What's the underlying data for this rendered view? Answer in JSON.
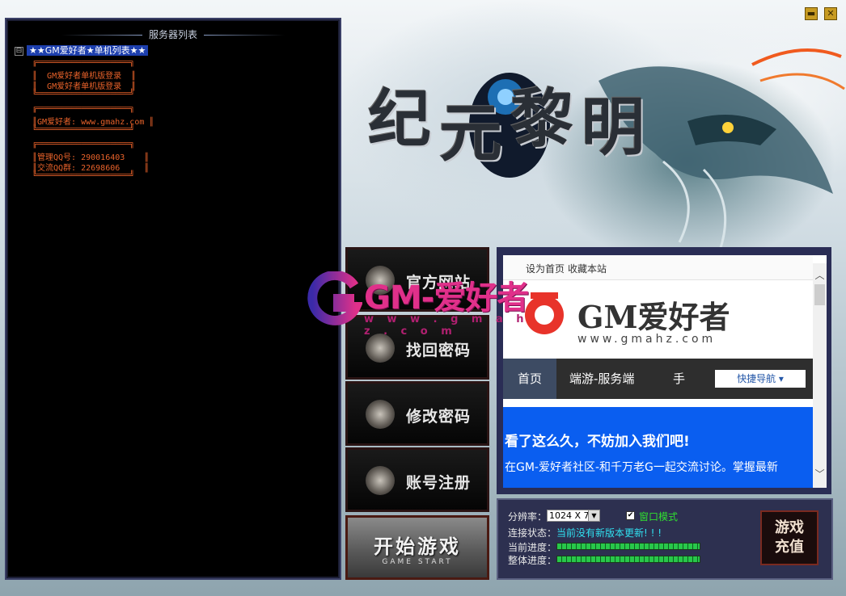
{
  "window": {
    "minimize_icon": "minimize-icon",
    "close_icon": "close-icon",
    "minimize_glyph": "▬",
    "close_glyph": "✕"
  },
  "server_list": {
    "title": "服务器列表",
    "root": "★★GM爱好者★单机列表★★",
    "expander": "⊟",
    "lines": [
      "╔═══════════════════╗",
      "║  GM爱好者单机版登录  ║",
      "║  GM爱好者单机版登录  ║",
      "╚═══════════════════╝",
      "╔═══════════════════╗",
      "║GM爱好者: www.gmahz.com ║",
      "╚═══════════════════╝",
      "╔═══════════════════╗",
      "║管理QQ号: 290016403    ║",
      "║交流QQ群: 22698606     ║",
      "╚═══════════════════╝"
    ]
  },
  "logo": {
    "chars": [
      "纪",
      "元",
      "黎",
      "明"
    ]
  },
  "side_buttons": [
    {
      "label": "官方网站",
      "icon": "emblem-icon"
    },
    {
      "label": "找回密码",
      "icon": "emblem-icon"
    },
    {
      "label": "修改密码",
      "icon": "emblem-icon"
    },
    {
      "label": "账号注册",
      "icon": "emblem-icon"
    }
  ],
  "start_button": {
    "label": "开始游戏",
    "sub": "GAME  START"
  },
  "browser": {
    "top_links": [
      "设为首页",
      "收藏本站"
    ],
    "site_name": "GM爱好者",
    "site_url": "www.gmahz.com",
    "nav": [
      "首页",
      "端游-服务端",
      "手"
    ],
    "quick_nav": "快捷导航 ▾",
    "banner_heading": "看了这么久，不妨加入我们吧!",
    "banner_text": "在GM-爱好者社区-和千万老G一起交流讨论。掌握最新",
    "scroll_up": "︿",
    "scroll_down": "﹀"
  },
  "settings": {
    "resolution_label": "分辨率：",
    "resolution_value": "1024 X 7",
    "windowed_label": "窗口模式",
    "windowed_checked": "✔",
    "status_label": "连接状态：",
    "status_value": "当前没有新版本更新! ! !",
    "current_progress_label": "当前进度：",
    "total_progress_label": "整体进度：",
    "current_progress": 1.0,
    "total_progress": 1.0
  },
  "recharge": {
    "line1": "游戏",
    "line2": "充值"
  },
  "watermark": {
    "text": "GM-爱好者",
    "url": "w w w . g m a h z . c o m"
  }
}
